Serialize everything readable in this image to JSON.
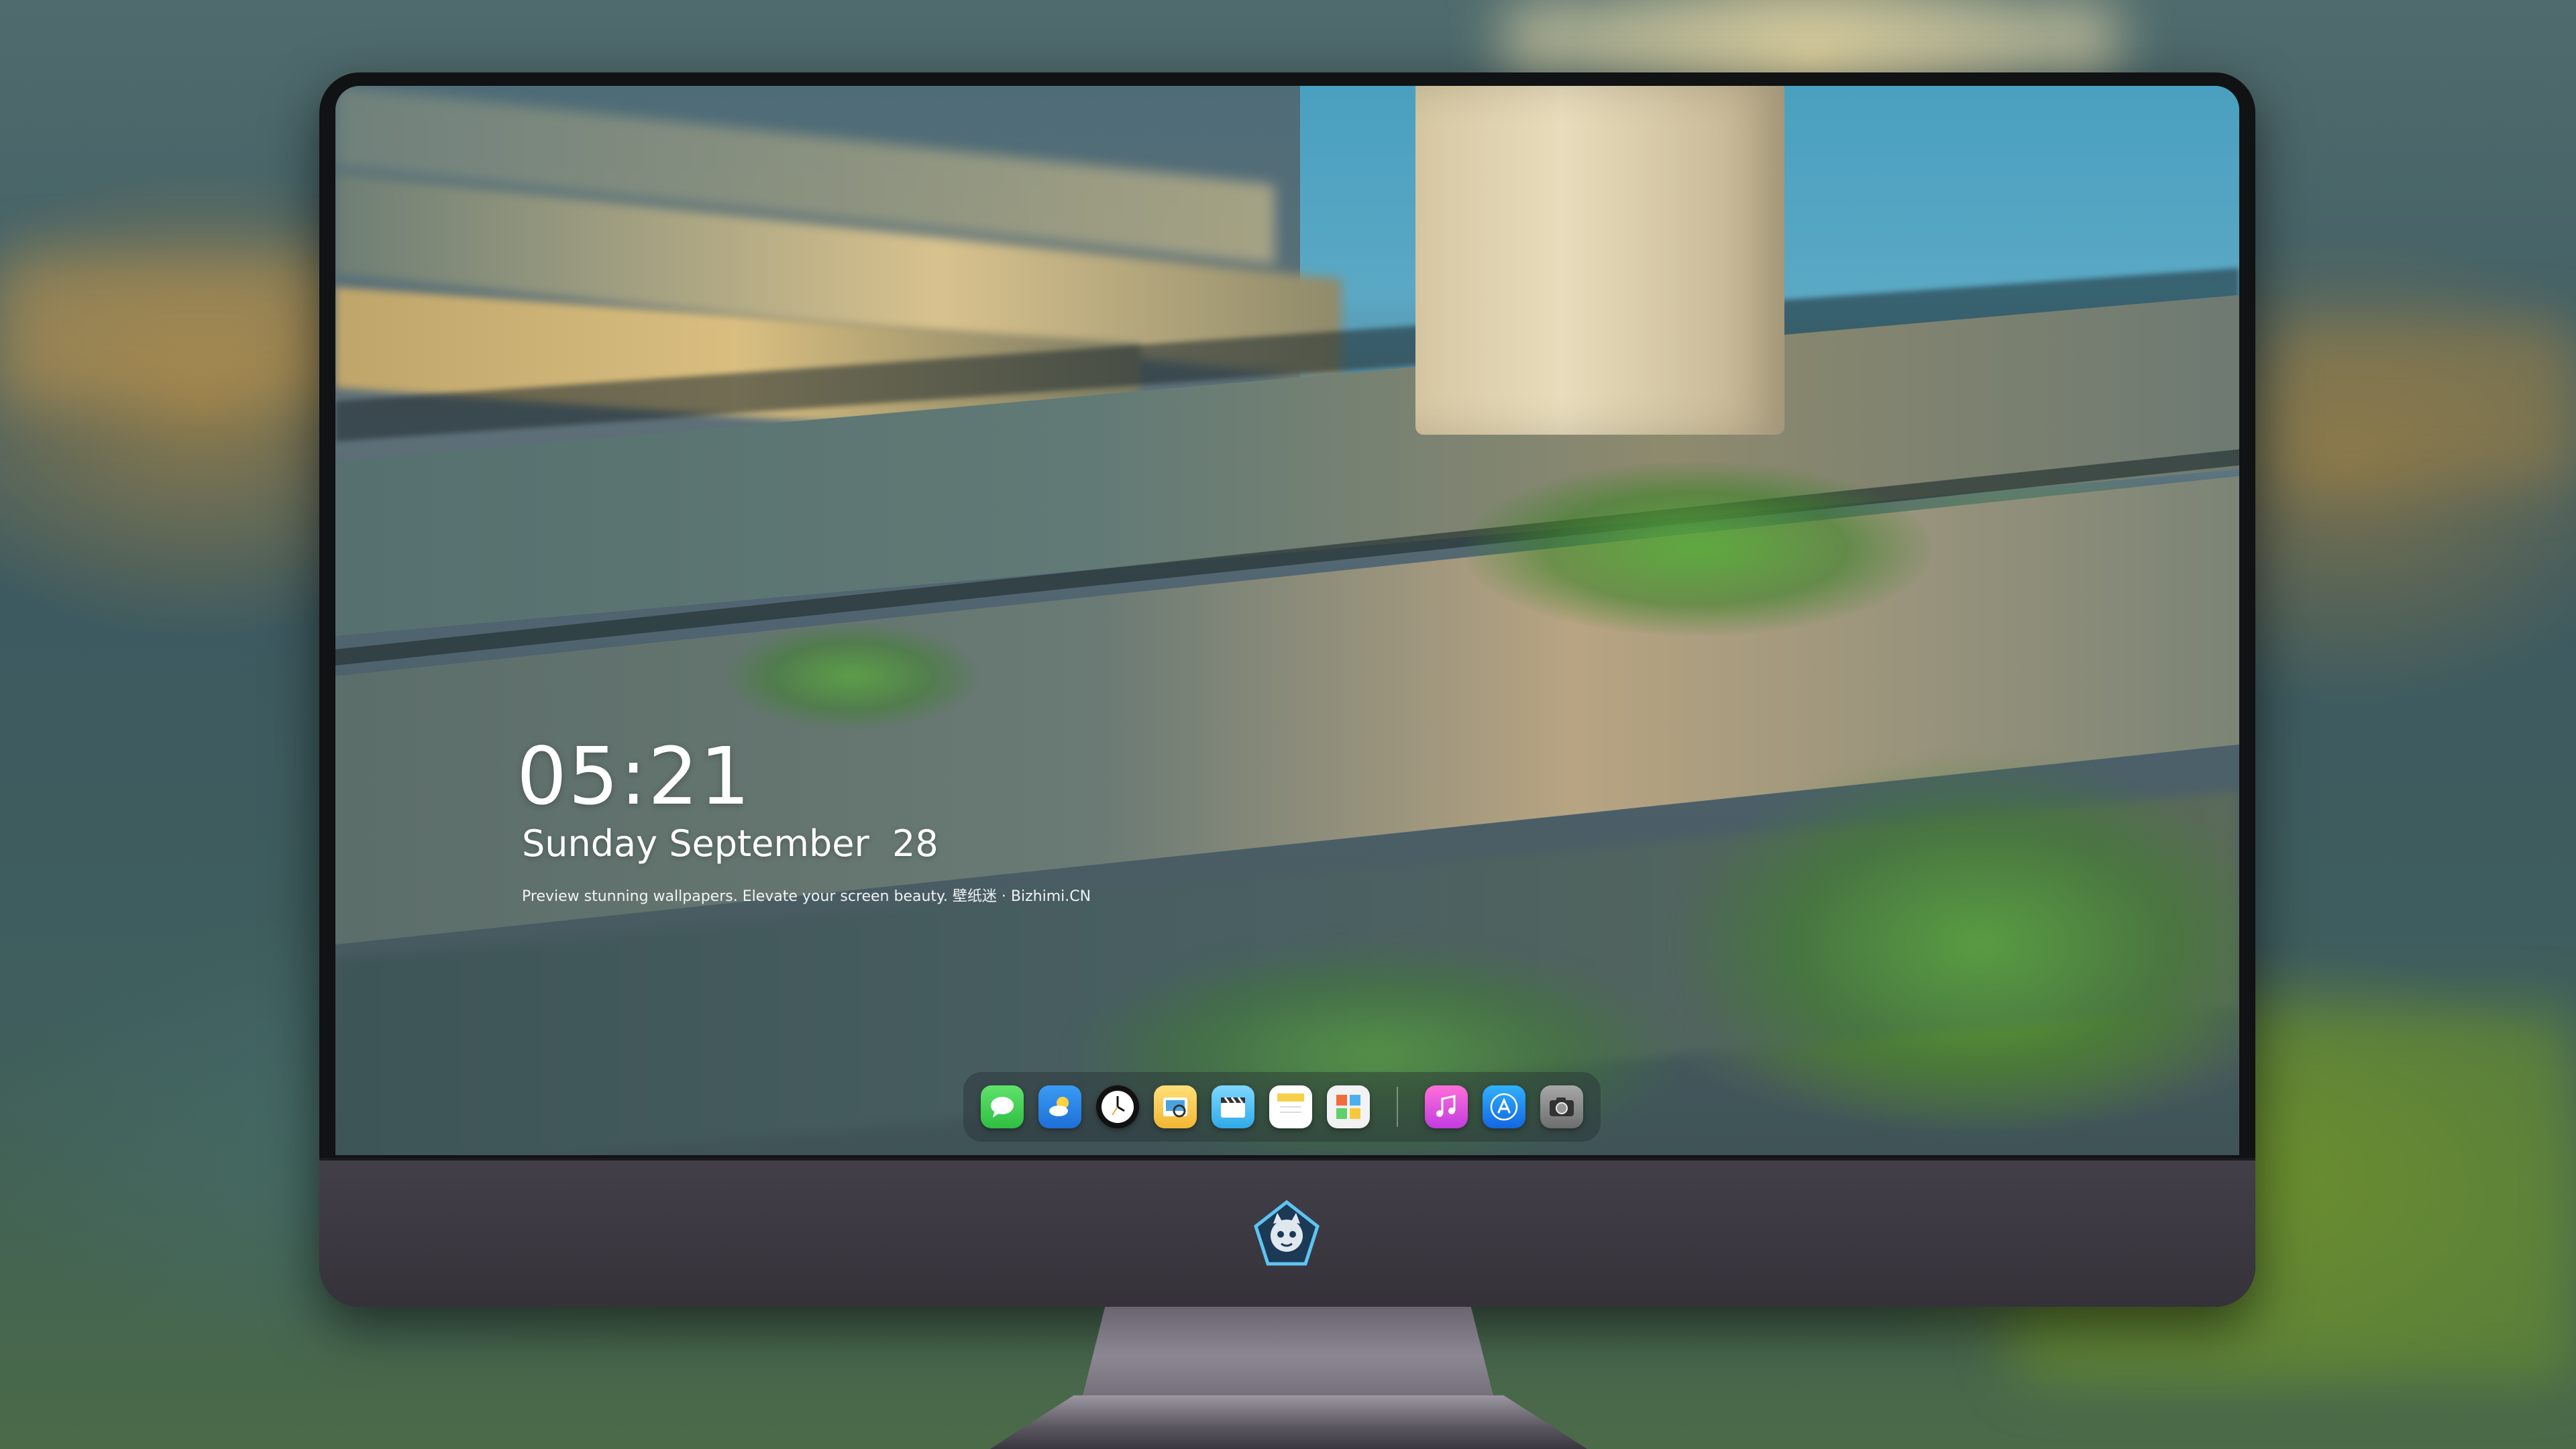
{
  "lock_screen": {
    "time": "05:21",
    "date": "Sunday September  28",
    "caption": "Preview stunning wallpapers. Elevate your screen beauty. 壁纸迷 · Bizhimi.CN"
  },
  "dock": {
    "apps": [
      {
        "name": "messages-icon",
        "color": "#3fd04f"
      },
      {
        "name": "weather-icon",
        "color": "#2f8cf0"
      },
      {
        "name": "clock-icon",
        "color": "#111111"
      },
      {
        "name": "preview-icon",
        "color": "#f3c54a"
      },
      {
        "name": "clips-icon",
        "color": "#4fc3f7"
      },
      {
        "name": "notes-icon",
        "color": "#f7d85c"
      },
      {
        "name": "photo-booth-icon",
        "color": "#e8e8e8"
      },
      {
        "name": "music-icon",
        "color": "#f05bd8"
      },
      {
        "name": "app-store-icon",
        "color": "#1e8ef0"
      },
      {
        "name": "camera-icon",
        "color": "#8a8a8a"
      }
    ]
  },
  "colors": {
    "monitor_bezel": "#111214",
    "monitor_chin": "#3c3941",
    "text": "#ffffff"
  }
}
